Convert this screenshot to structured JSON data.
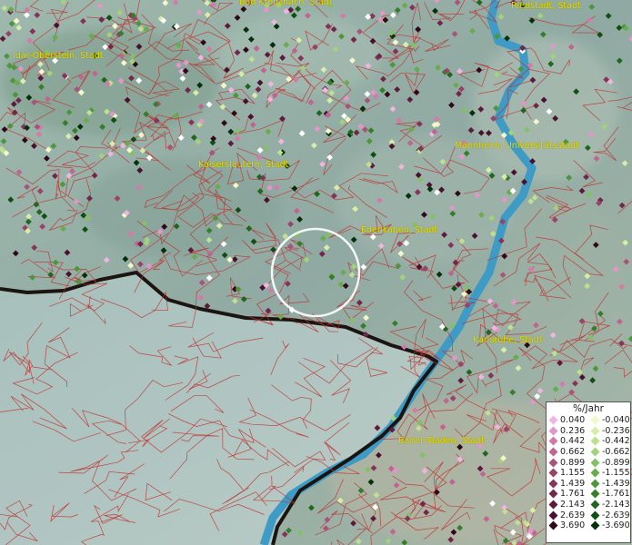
{
  "cities": [
    {
      "id": "bad-kreuznach",
      "label": "Bad Kreuznach, Stadt"
    },
    {
      "id": "riedstadt",
      "label": "Riedstadt, Stadt"
    },
    {
      "id": "idar-oberstein",
      "label": "Idar-Oberstein, Stadt"
    },
    {
      "id": "mannheim",
      "label": "Mannheim, Universitätsstadt"
    },
    {
      "id": "kaiserslautern",
      "label": "Kaiserslautern, Stadt"
    },
    {
      "id": "edenkoben",
      "label": "Edenkoben, Stadt"
    },
    {
      "id": "karlsruhe",
      "label": "Karlsruhe, Stadt"
    },
    {
      "id": "baden-baden",
      "label": "Baden-Baden, Stadt"
    }
  ],
  "legend": {
    "title": "%/Jahr",
    "rows": [
      {
        "pos": "0.040",
        "pos_color": "#f0b4e0",
        "neg": "-0.040",
        "neg_color": "#f2f8c8"
      },
      {
        "pos": "0.236",
        "pos_color": "#e596c8",
        "neg": "-0.236",
        "neg_color": "#d8eda8"
      },
      {
        "pos": "0.442",
        "pos_color": "#d47aa8",
        "neg": "-0.442",
        "neg_color": "#bfe08e"
      },
      {
        "pos": "0.662",
        "pos_color": "#c06490",
        "neg": "-0.662",
        "neg_color": "#a2d27a"
      },
      {
        "pos": "0.899",
        "pos_color": "#ab527a",
        "neg": "-0.899",
        "neg_color": "#84c064"
      },
      {
        "pos": "1.155",
        "pos_color": "#9a4268",
        "neg": "-1.155",
        "neg_color": "#68ac4c"
      },
      {
        "pos": "1.439",
        "pos_color": "#86325a",
        "neg": "-1.439",
        "neg_color": "#4e963a"
      },
      {
        "pos": "1.761",
        "pos_color": "#72264a",
        "neg": "-1.761",
        "neg_color": "#357e2a"
      },
      {
        "pos": "2.143",
        "pos_color": "#5e1a3c",
        "neg": "-2.143",
        "neg_color": "#20661e"
      },
      {
        "pos": "2.639",
        "pos_color": "#4a1030",
        "neg": "-2.639",
        "neg_color": "#104e14"
      },
      {
        "pos": "3.690",
        "pos_color": "#300818",
        "neg": "-3.690",
        "neg_color": "#04300a"
      }
    ]
  }
}
